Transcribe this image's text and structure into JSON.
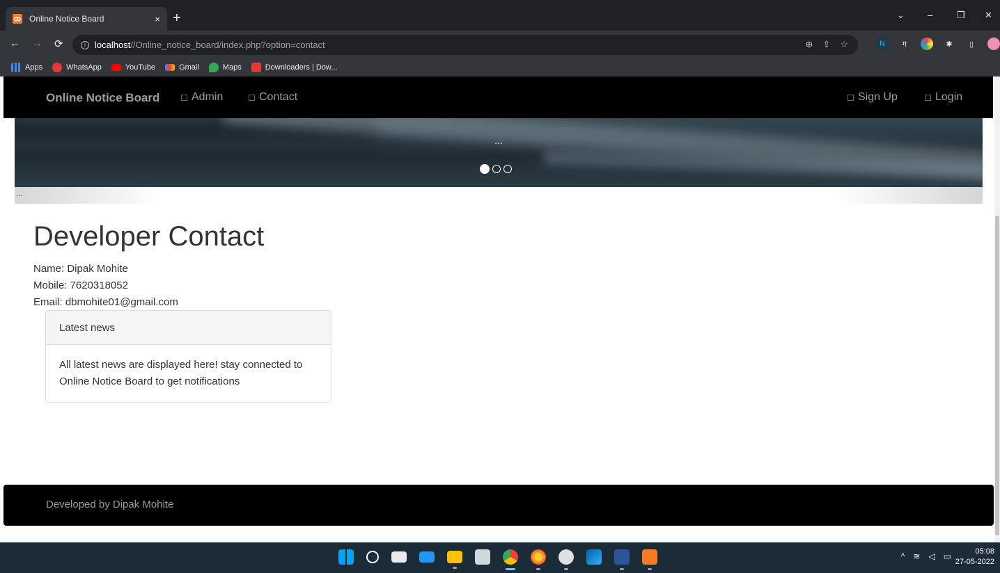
{
  "browser": {
    "tab_title": "Online Notice Board",
    "tab_close": "×",
    "new_tab": "+",
    "url_host": "localhost",
    "url_path": "//Online_notice_board/index.php?option=contact",
    "window_controls": {
      "dropdown": "⌄",
      "minimize": "–",
      "restore": "❐",
      "close": "✕"
    },
    "bookmarks": [
      {
        "label": "Apps",
        "color": "#4285f4"
      },
      {
        "label": "WhatsApp",
        "color": "#e53935"
      },
      {
        "label": "YouTube",
        "color": "#ff0000"
      },
      {
        "label": "Gmail",
        "color": "#ea4335"
      },
      {
        "label": "Maps",
        "color": "#34a853"
      },
      {
        "label": "Downloaders | Dow...",
        "color": "#e53935"
      }
    ]
  },
  "navbar": {
    "brand": "Online Notice Board",
    "links": {
      "admin": "Admin",
      "contact": "Contact",
      "signup": "Sign Up",
      "login": "Login"
    }
  },
  "carousel": {
    "caption": "...",
    "slide_count": 3,
    "active_slide": 1
  },
  "strip_text": "...",
  "main": {
    "title": "Developer Contact",
    "name_line": "Name: Dipak Mohite",
    "mobile_line": "Mobile: 7620318052",
    "email_line": "Email: dbmohite01@gmail.com"
  },
  "panel": {
    "heading": "Latest news",
    "body": "All latest news are displayed here! stay connected to Online Notice Board to get notifications"
  },
  "footer": {
    "text": "Developed by Dipak Mohite"
  },
  "taskbar": {
    "time": "05:08",
    "date": "27-05-2022",
    "tray": "^"
  },
  "colors": {
    "navbar_bg": "#000000",
    "navbar_text": "#9d9d9d",
    "chrome_dark": "#202124",
    "chrome_toolbar": "#35363a",
    "taskbar": "#1c2b38"
  }
}
